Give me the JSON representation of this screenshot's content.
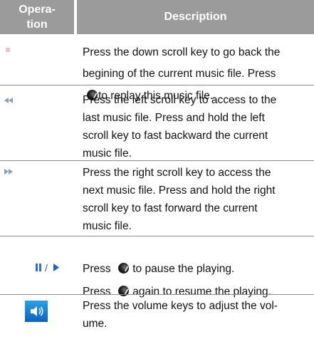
{
  "header": {
    "operation_line1": "Opera-",
    "operation_line2": "tion",
    "description": "Description"
  },
  "rows": [
    {
      "icon": "stop-icon",
      "lines": [
        "Press the down scroll key to go back the",
        "begining of the current music file. Press",
        "to replay this music file."
      ]
    },
    {
      "icon": "rewind-icon",
      "lines": [
        "Press the left scroll key to access to the",
        "last music file. Press and hold the left",
        "scroll key to fast backward the current",
        "music file."
      ]
    },
    {
      "icon": "fast-forward-icon",
      "lines": [
        "Press the right scroll key to access the",
        "next music file. Press and hold the right",
        "scroll key to fast forward the current",
        "music file."
      ]
    },
    {
      "icon": "pause-play-icon",
      "separator": "/",
      "lines": [
        "to pause the playing.",
        "again to resume the playing."
      ],
      "prefix": "Press"
    },
    {
      "icon": "volume-icon",
      "lines": [
        "Press the volume keys to adjust the vol-",
        "ume."
      ]
    }
  ],
  "colors": {
    "header_bg": "#9b9b9b",
    "header_text": "#ffffff",
    "rule": "#8a8a8a",
    "icon_blue": "#1b63c6",
    "stop_pink": "#e8c6cc"
  }
}
